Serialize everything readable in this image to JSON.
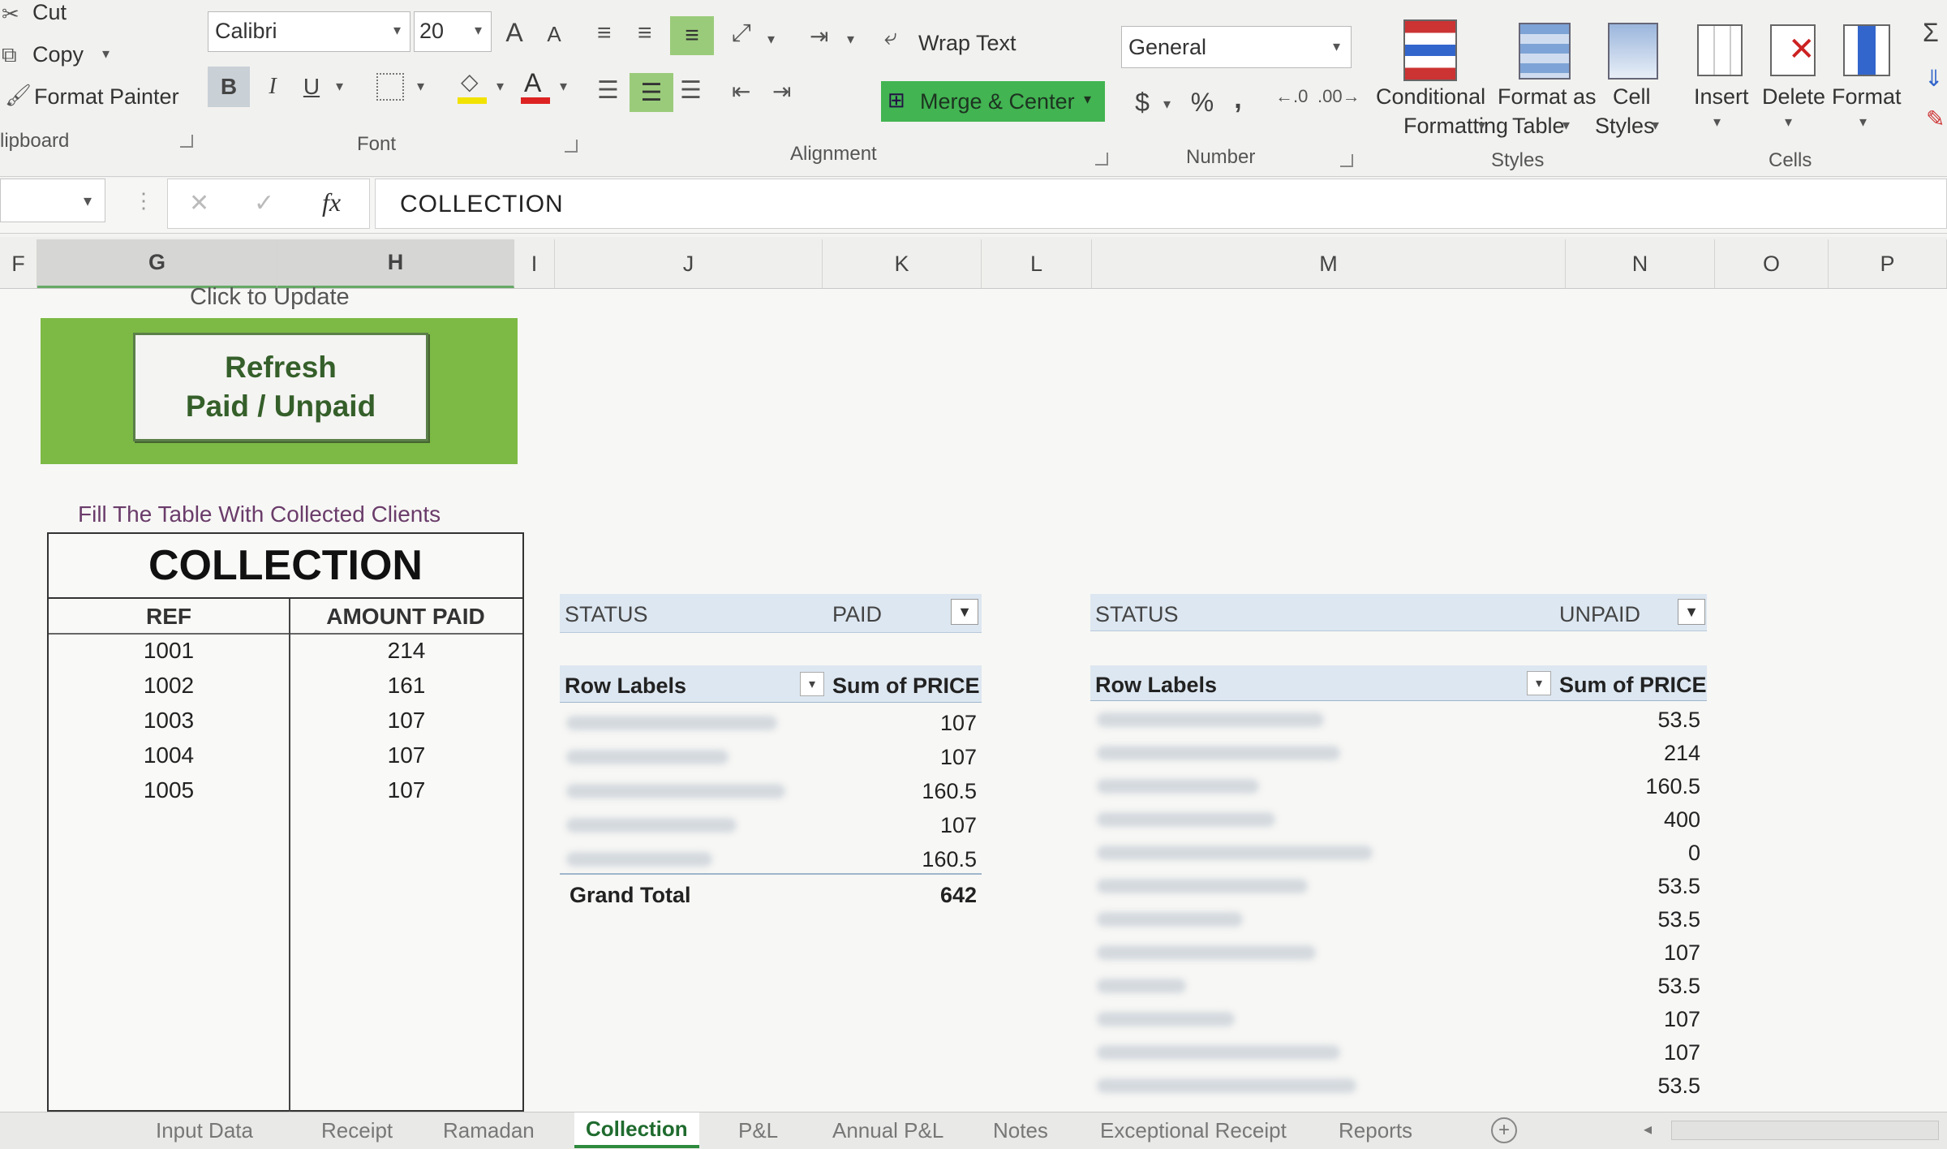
{
  "clipboard": {
    "cut": "Cut",
    "copy": "Copy",
    "format_painter": "Format Painter",
    "group": "lipboard"
  },
  "font": {
    "name": "Calibri",
    "size": "20",
    "group": "Font",
    "bold": "B",
    "italic": "I",
    "underline": "U",
    "grow": "A",
    "shrink": "A",
    "color_a": "A"
  },
  "alignment": {
    "wrap": "Wrap Text",
    "merge": "Merge & Center",
    "group": "Alignment"
  },
  "number": {
    "format": "General",
    "currency": "$",
    "percent": "%",
    "comma": ",",
    "group": "Number"
  },
  "styles": {
    "conditional_1": "Conditional",
    "conditional_2": "Formatting",
    "table_1": "Format as",
    "table_2": "Table",
    "cell_1": "Cell",
    "cell_2": "Styles",
    "group": "Styles"
  },
  "cells": {
    "insert": "Insert",
    "delete": "Delete",
    "format": "Format",
    "group": "Cells"
  },
  "formula_bar": {
    "value": "COLLECTION"
  },
  "columns": [
    "F",
    "G",
    "H",
    "I",
    "J",
    "K",
    "L",
    "M",
    "N",
    "O",
    "P"
  ],
  "refresh": {
    "hint": "Click to Update",
    "line1": "Refresh",
    "line2": "Paid / Unpaid"
  },
  "collection": {
    "instruction": "Fill The Table With Collected Clients",
    "title": "COLLECTION",
    "col_ref": "REF",
    "col_amount": "AMOUNT PAID",
    "rows": [
      {
        "ref": "1001",
        "amount": "214"
      },
      {
        "ref": "1002",
        "amount": "161"
      },
      {
        "ref": "1003",
        "amount": "107"
      },
      {
        "ref": "1004",
        "amount": "107"
      },
      {
        "ref": "1005",
        "amount": "107"
      }
    ]
  },
  "paid_pivot": {
    "filter_label": "STATUS",
    "filter_value": "PAID",
    "row_labels": "Row Labels",
    "sum_label": "Sum of PRICE",
    "values": [
      "107",
      "107",
      "160.5",
      "107",
      "160.5"
    ],
    "grand_total_label": "Grand Total",
    "grand_total": "642"
  },
  "unpaid_pivot": {
    "filter_label": "STATUS",
    "filter_value": "UNPAID",
    "row_labels": "Row Labels",
    "sum_label": "Sum of PRICE",
    "values": [
      "53.5",
      "214",
      "160.5",
      "400",
      "0",
      "53.5",
      "53.5",
      "107",
      "53.5",
      "107",
      "107",
      "53.5"
    ]
  },
  "tabs": [
    "Input Data",
    "Receipt",
    "Ramadan",
    "Collection",
    "P&L",
    "Annual P&L",
    "Notes",
    "Exceptional Receipt",
    "Reports"
  ],
  "active_tab": "Collection",
  "colors": {
    "green_block": "#7cba45",
    "accent_green": "#3aa84a",
    "pivot_header": "#dde7f1"
  }
}
